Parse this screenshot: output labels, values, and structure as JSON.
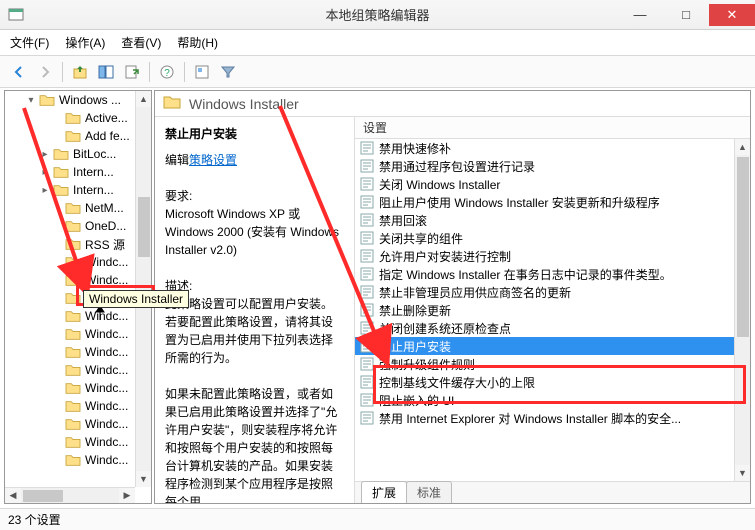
{
  "window": {
    "title": "本地组策略编辑器",
    "min": "―",
    "max": "□",
    "close": "✕"
  },
  "menu": {
    "file": "文件(F)",
    "action": "操作(A)",
    "view": "查看(V)",
    "help": "帮助(H)"
  },
  "tree": {
    "items": [
      {
        "indent": 40,
        "tw": "▾",
        "label": "Windows ..."
      },
      {
        "indent": 66,
        "tw": "",
        "label": "Active..."
      },
      {
        "indent": 66,
        "tw": "",
        "label": "Add fe..."
      },
      {
        "indent": 54,
        "tw": "▸",
        "label": "BitLoc..."
      },
      {
        "indent": 54,
        "tw": "▸",
        "label": "Intern..."
      },
      {
        "indent": 54,
        "tw": "▸",
        "label": "Intern..."
      },
      {
        "indent": 66,
        "tw": "",
        "label": "NetM..."
      },
      {
        "indent": 66,
        "tw": "",
        "label": "OneD..."
      },
      {
        "indent": 66,
        "tw": "",
        "label": "RSS 源"
      },
      {
        "indent": 66,
        "tw": "",
        "label": "Windc..."
      },
      {
        "indent": 66,
        "tw": "",
        "label": "Windc..."
      },
      {
        "indent": 66,
        "tw": "",
        "label": "Windc..."
      },
      {
        "indent": 66,
        "tw": "",
        "label": "Windc..."
      },
      {
        "indent": 66,
        "tw": "",
        "label": "Windc..."
      },
      {
        "indent": 66,
        "tw": "",
        "label": "Windc..."
      },
      {
        "indent": 66,
        "tw": "",
        "label": "Windc..."
      },
      {
        "indent": 66,
        "tw": "",
        "label": "Windc..."
      },
      {
        "indent": 66,
        "tw": "",
        "label": "Windc..."
      },
      {
        "indent": 66,
        "tw": "",
        "label": "Windc..."
      },
      {
        "indent": 66,
        "tw": "",
        "label": "Windc..."
      },
      {
        "indent": 66,
        "tw": "",
        "label": "Windc..."
      }
    ],
    "tooltip": "Windows Installer"
  },
  "content": {
    "title": "Windows Installer",
    "details": {
      "heading": "禁止用户安装",
      "edit_prefix": "编辑",
      "edit_link": "策略设置",
      "req_label": "要求:",
      "req_text": "Microsoft Windows XP 或 Windows 2000 (安装有 Windows Installer v2.0)",
      "desc_label": "描述:",
      "desc1": "此策略设置可以配置用户安装。若要配置此策略设置，请将其设置为已启用并使用下拉列表选择所需的行为。",
      "desc2": "如果未配置此策略设置，或者如果已启用此策略设置并选择了\"允许用户安装\"，则安装程序将允许和按照每个用户安装的和按照每台计算机安装的产品。如果安装程序检测到某个应用程序是按照每个用..."
    },
    "column": "设置",
    "rows": [
      {
        "label": "禁用快速修补",
        "sel": false
      },
      {
        "label": "禁用通过程序包设置进行记录",
        "sel": false
      },
      {
        "label": "关闭 Windows Installer",
        "sel": false
      },
      {
        "label": "阻止用户使用 Windows Installer 安装更新和升级程序",
        "sel": false
      },
      {
        "label": "禁用回滚",
        "sel": false
      },
      {
        "label": "关闭共享的组件",
        "sel": false
      },
      {
        "label": "允许用户对安装进行控制",
        "sel": false
      },
      {
        "label": "指定 Windows Installer 在事务日志中记录的事件类型。",
        "sel": false
      },
      {
        "label": "禁止非管理员应用供应商签名的更新",
        "sel": false
      },
      {
        "label": "禁止删除更新",
        "sel": false
      },
      {
        "label": "关闭创建系统还原检查点",
        "sel": false
      },
      {
        "label": "禁止用户安装",
        "sel": true
      },
      {
        "label": "强制升级组件规则",
        "sel": false
      },
      {
        "label": "控制基线文件缓存大小的上限",
        "sel": false
      },
      {
        "label": "阻止嵌入的 UI",
        "sel": false
      },
      {
        "label": "禁用 Internet Explorer 对 Windows Installer 脚本的安全...",
        "sel": false
      }
    ],
    "tabs": {
      "extended": "扩展",
      "standard": "标准"
    }
  },
  "status": "23 个设置"
}
